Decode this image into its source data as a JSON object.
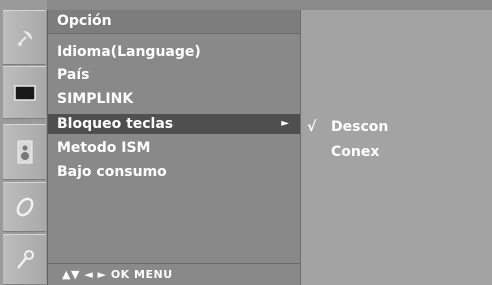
{
  "sidebar": {
    "icons": [
      "satellite-dish-icon",
      "screen-icon",
      "speaker-icon",
      "option-disc-icon",
      "lock-key-icon"
    ]
  },
  "menu": {
    "title": "Opción",
    "items": [
      {
        "label": "Idioma(Language)"
      },
      {
        "label": "País"
      },
      {
        "label": "SIMPLINK"
      },
      {
        "label": "Bloqueo teclas",
        "arrow": "►"
      },
      {
        "label": "Metodo ISM"
      },
      {
        "label": "Bajo consumo"
      }
    ],
    "footer": "▲▼  ◄ ►  OK  MENU"
  },
  "submenu": {
    "items": [
      {
        "check": "√",
        "label": "Descon"
      },
      {
        "check": "",
        "label": "Conex"
      }
    ]
  },
  "colors": {
    "panel": "#898989",
    "selected": "#4f4f4f",
    "submenu": "#a3a3a3"
  }
}
